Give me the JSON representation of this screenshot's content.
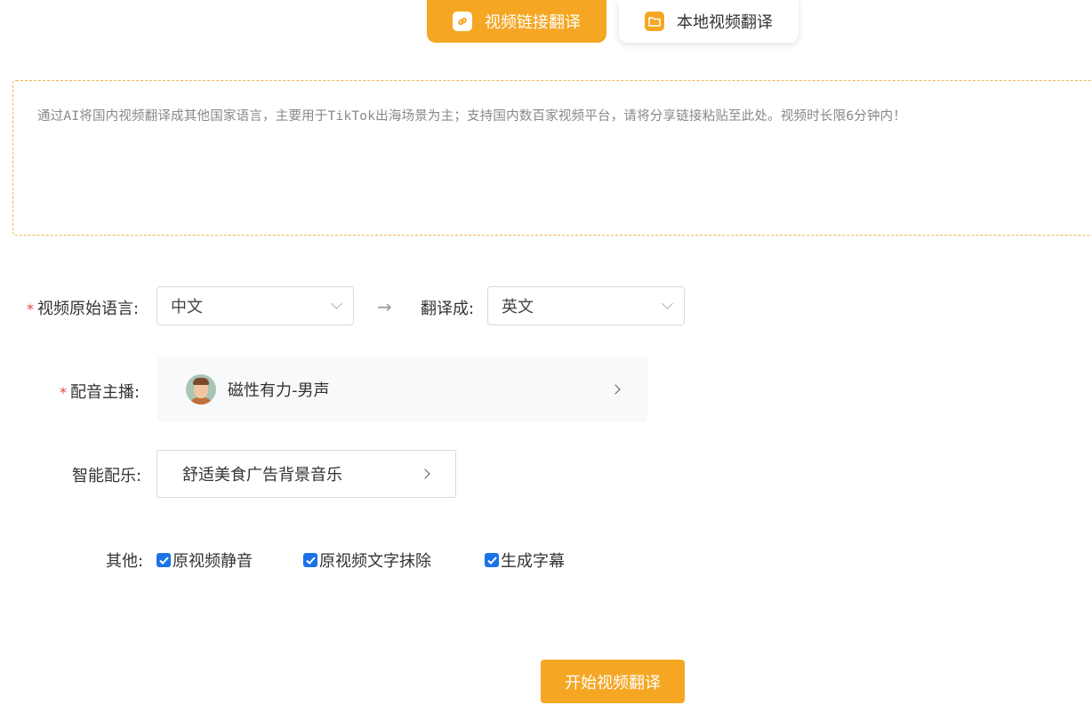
{
  "tabs": [
    {
      "label": "视频链接翻译",
      "icon": "link-icon",
      "active": true
    },
    {
      "label": "本地视频翻译",
      "icon": "folder-icon",
      "active": false
    }
  ],
  "url_input": {
    "placeholder": "通过AI将国内视频翻译成其他国家语言，主要用于TikTok出海场景为主；支持国内数百家视频平台，请将分享链接粘贴至此处。视频时长限6分钟内！",
    "value": ""
  },
  "language": {
    "source_label": "视频原始语言:",
    "source_value": "中文",
    "target_label": "翻译成:",
    "target_value": "英文",
    "arrow": "→"
  },
  "voice": {
    "label": "配音主播:",
    "name": "磁性有力-男声"
  },
  "music": {
    "label": "智能配乐:",
    "value": "舒适美食广告背景音乐"
  },
  "other": {
    "label": "其他:",
    "options": [
      {
        "label": "原视频静音",
        "checked": true
      },
      {
        "label": "原视频文字抹除",
        "checked": true
      },
      {
        "label": "生成字幕",
        "checked": true
      }
    ]
  },
  "required_mark": "*",
  "start_button": "开始视频翻译",
  "colors": {
    "accent": "#f5a623",
    "required": "#e0443a",
    "checkbox": "#1a73e8"
  }
}
